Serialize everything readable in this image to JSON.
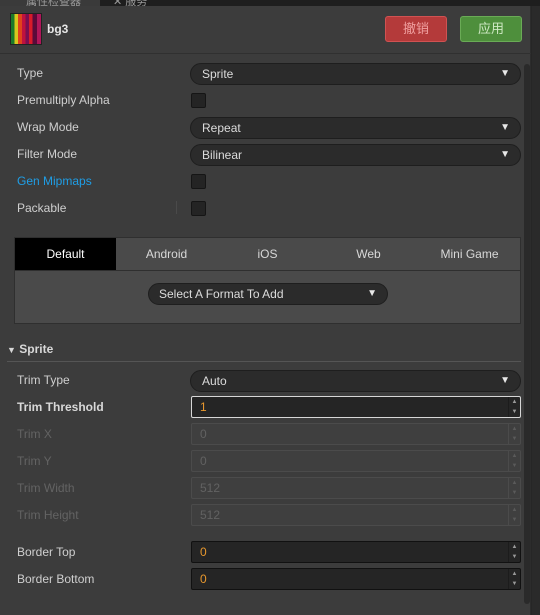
{
  "top_tabs": {
    "inspector_label": "属性检查器",
    "service_label": "服务"
  },
  "header": {
    "asset_name": "bg3",
    "revert_label": "撤销",
    "apply_label": "应用"
  },
  "texture": {
    "type_label": "Type",
    "type_value": "Sprite",
    "premultiply_label": "Premultiply Alpha",
    "premultiply_checked": false,
    "wrap_label": "Wrap Mode",
    "wrap_value": "Repeat",
    "filter_label": "Filter Mode",
    "filter_value": "Bilinear",
    "mipmaps_label": "Gen Mipmaps",
    "mipmaps_checked": false,
    "packable_label": "Packable",
    "packable_checked": false
  },
  "platforms": {
    "tabs": [
      "Default",
      "Android",
      "iOS",
      "Web",
      "Mini Game"
    ],
    "active": "Default",
    "format_placeholder": "Select A Format To Add"
  },
  "sprite": {
    "section_label": "Sprite",
    "trim_type_label": "Trim Type",
    "trim_type_value": "Auto",
    "trim_threshold_label": "Trim Threshold",
    "trim_threshold_value": "1",
    "trim_x_label": "Trim X",
    "trim_x_value": "0",
    "trim_y_label": "Trim Y",
    "trim_y_value": "0",
    "trim_width_label": "Trim Width",
    "trim_width_value": "512",
    "trim_height_label": "Trim Height",
    "trim_height_value": "512",
    "border_top_label": "Border Top",
    "border_top_value": "0",
    "border_bottom_label": "Border Bottom",
    "border_bottom_value": "0"
  },
  "icons": {
    "dropdown": "chevron-down-icon",
    "section_toggle": "triangle-down-icon",
    "spin_up": "spin-up-icon",
    "spin_down": "spin-down-icon"
  },
  "colors": {
    "revert_button": "#b43a3a",
    "apply_button": "#4e8f3c",
    "link_label": "#1f9ee6",
    "number_value": "#e8982e",
    "active_platform_tab": "#000000"
  }
}
